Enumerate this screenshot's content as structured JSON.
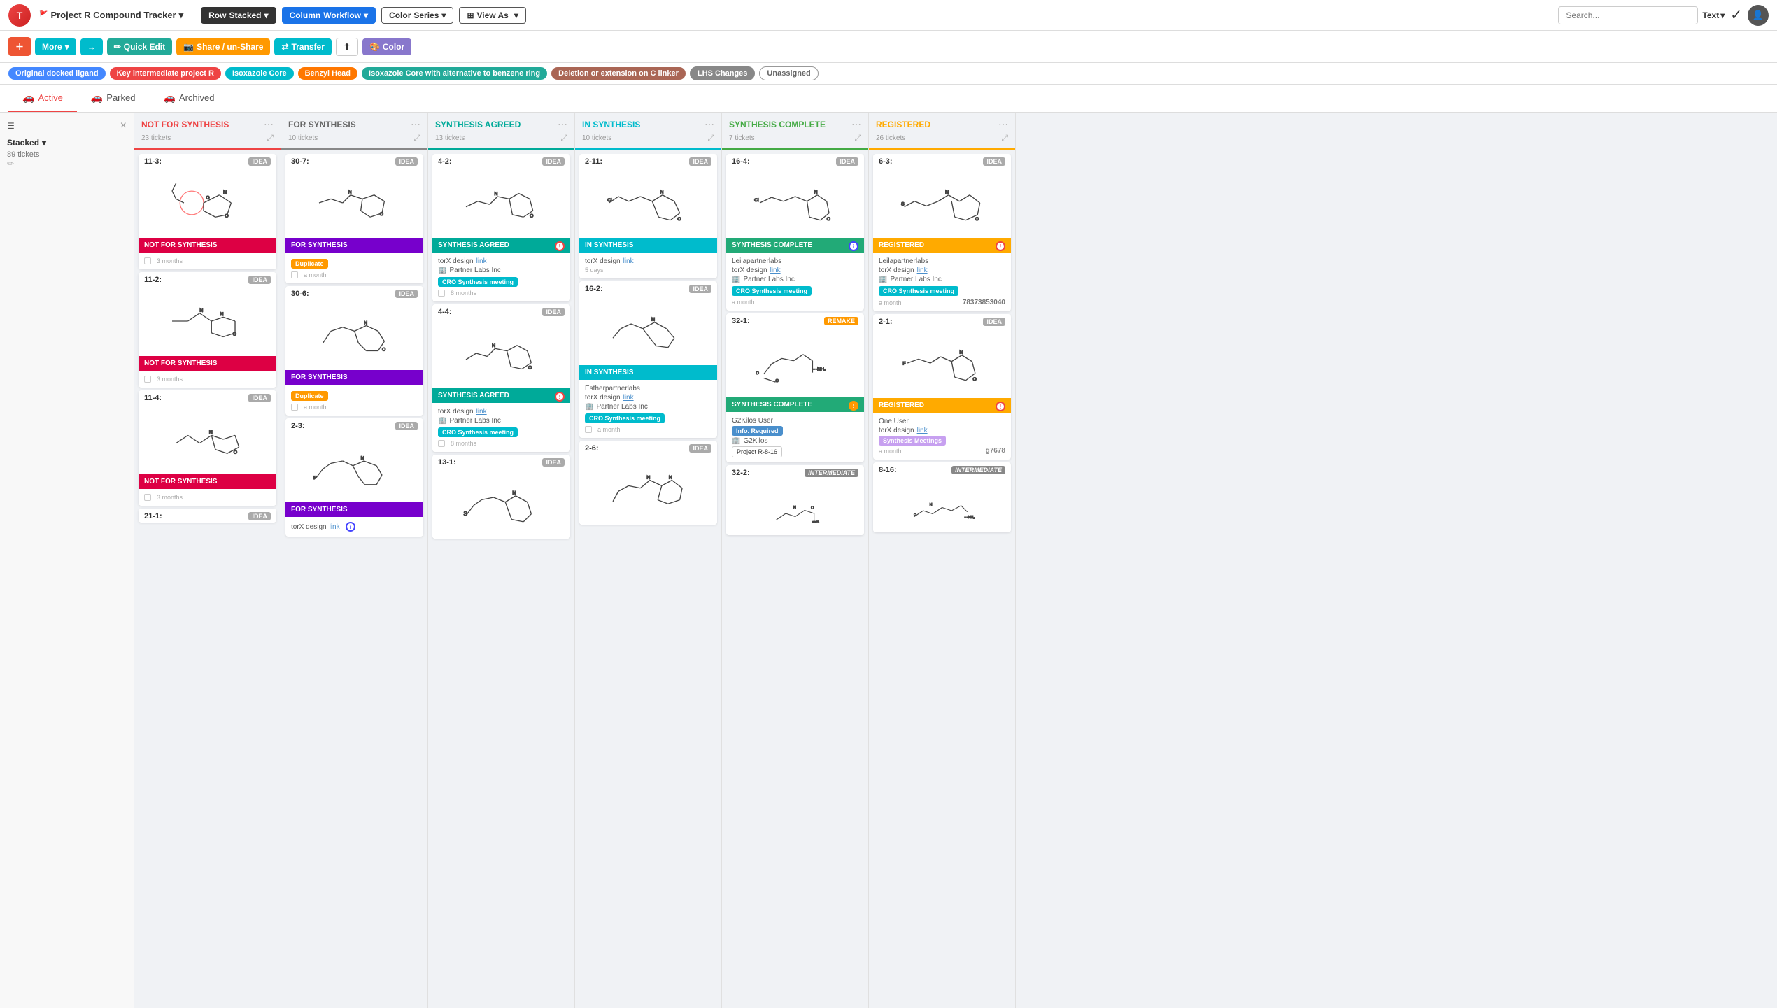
{
  "app": {
    "logo": "T",
    "project": "Project R Compound Tracker",
    "checkmark": "✓"
  },
  "topnav": {
    "row_label": "Row",
    "row_value": "Stacked",
    "col_label": "Column",
    "col_value": "Workflow",
    "color_label": "Color",
    "color_value": "Series",
    "viewas_label": "View As",
    "search_placeholder": "Search...",
    "text_label": "Text"
  },
  "toolbar": {
    "more_label": "More",
    "quick_edit_label": "Quick Edit",
    "share_label": "Share / un-Share",
    "transfer_label": "Transfer",
    "share_icon_label": "share",
    "color_label": "Color"
  },
  "tags": [
    {
      "label": "Original docked ligand",
      "color": "blue"
    },
    {
      "label": "Key intermediate project R",
      "color": "pink"
    },
    {
      "label": "Isoxazole Core",
      "color": "cyan"
    },
    {
      "label": "Benzyl Head",
      "color": "orange"
    },
    {
      "label": "Isoxazole Core with alternative to benzene ring",
      "color": "green"
    },
    {
      "label": "Deletion or extension on C linker",
      "color": "brown"
    },
    {
      "label": "LHS Changes",
      "color": "gray"
    },
    {
      "label": "Unassigned",
      "color": "outline-gray"
    }
  ],
  "tabs": [
    {
      "label": "Active",
      "icon": "🚗",
      "active": true
    },
    {
      "label": "Parked",
      "icon": "🚗",
      "active": false
    },
    {
      "label": "Archived",
      "icon": "🚗",
      "active": false
    }
  ],
  "sidebar": {
    "filter_label": "Filter",
    "close_label": "×",
    "stacked_label": "Stacked",
    "tickets_label": "89 tickets"
  },
  "columns": [
    {
      "id": "not-for-synthesis",
      "title": "NOT FOR SYNTHESIS",
      "title_class": "not-synthesis",
      "divider_class": "not-synthesis",
      "tickets": "23 tickets",
      "cards": [
        {
          "id": "11-3",
          "badge": "IDEA",
          "badge_class": "idea",
          "has_molecule": true,
          "status": "NOT FOR SYNTHESIS",
          "status_class": "magenta",
          "time": "3 months",
          "has_checkbox": true
        },
        {
          "id": "11-2",
          "badge": "IDEA",
          "badge_class": "idea",
          "has_molecule": true,
          "status": "NOT FOR SYNTHESIS",
          "status_class": "magenta",
          "time": "3 months",
          "has_checkbox": true
        },
        {
          "id": "11-4",
          "badge": "IDEA",
          "badge_class": "idea",
          "has_molecule": true,
          "status": "NOT FOR SYNTHESIS",
          "status_class": "magenta",
          "time": "3 months",
          "has_checkbox": true
        },
        {
          "id": "21-1",
          "badge": "IDEA",
          "badge_class": "idea",
          "has_molecule": true,
          "status": "",
          "status_class": "",
          "time": ""
        }
      ]
    },
    {
      "id": "for-synthesis",
      "title": "FOR SYNTHESIS",
      "title_class": "for-synthesis",
      "divider_class": "for-synthesis",
      "tickets": "10 tickets",
      "cards": [
        {
          "id": "30-7",
          "badge": "IDEA",
          "badge_class": "idea",
          "has_molecule": true,
          "status": "FOR SYNTHESIS",
          "status_class": "purple",
          "time": "a month",
          "has_checkbox": true,
          "duplicate_tag": true
        },
        {
          "id": "30-6",
          "badge": "IDEA",
          "badge_class": "idea",
          "has_molecule": true,
          "status": "FOR SYNTHESIS",
          "status_class": "purple",
          "time": "a month",
          "has_checkbox": true,
          "duplicate_tag": true
        },
        {
          "id": "2-3",
          "badge": "IDEA",
          "badge_class": "idea",
          "has_molecule": true,
          "status": "FOR SYNTHESIS",
          "status_class": "purple",
          "time": "",
          "has_checkbox": false,
          "design_link": true
        }
      ]
    },
    {
      "id": "synthesis-agreed",
      "title": "SYNTHESIS AGREED",
      "title_class": "synthesis-agreed",
      "divider_class": "synthesis-agreed",
      "tickets": "13 tickets",
      "cards": [
        {
          "id": "4-2",
          "badge": "IDEA",
          "badge_class": "idea",
          "has_molecule": true,
          "status": "SYNTHESIS AGREED",
          "status_class": "green",
          "dot": "red",
          "partner": "Partner Labs Inc",
          "cro_tag": true,
          "time": "8 months",
          "has_checkbox": true,
          "design_link": true
        },
        {
          "id": "4-4",
          "badge": "IDEA",
          "badge_class": "idea",
          "has_molecule": true,
          "status": "SYNTHESIS AGREED",
          "status_class": "green",
          "dot": "red",
          "partner": "Partner Labs Inc",
          "cro_tag": true,
          "time": "8 months",
          "has_checkbox": true,
          "design_link": true
        },
        {
          "id": "13-1",
          "badge": "IDEA",
          "badge_class": "idea",
          "has_molecule": true,
          "status": "",
          "status_class": "",
          "time": ""
        }
      ]
    },
    {
      "id": "in-synthesis",
      "title": "IN SYNTHESIS",
      "title_class": "in-synthesis",
      "divider_class": "in-synthesis",
      "tickets": "10 tickets",
      "cards": [
        {
          "id": "2-11",
          "badge": "IDEA",
          "badge_class": "idea",
          "has_molecule": true,
          "status": "IN SYNTHESIS",
          "status_class": "cyan",
          "partner": "Partner Labs Inc",
          "cro_tag": true,
          "time": "5 days",
          "has_checkbox": true,
          "design_link": true
        },
        {
          "id": "16-2",
          "badge": "IDEA",
          "badge_class": "idea",
          "has_molecule": true,
          "status": "IN SYNTHESIS",
          "status_class": "cyan",
          "partner": "Estherpartnerlabs",
          "cro_tag": true,
          "time": "a month",
          "has_checkbox": true,
          "design_link": true
        },
        {
          "id": "2-6",
          "badge": "IDEA",
          "badge_class": "idea",
          "has_molecule": true,
          "status": "",
          "status_class": "",
          "time": ""
        }
      ]
    },
    {
      "id": "synthesis-complete",
      "title": "SYNTHESIS COMPLETE",
      "title_class": "synthesis-complete",
      "divider_class": "synthesis-complete",
      "tickets": "7 tickets",
      "cards": [
        {
          "id": "16-4",
          "badge": "IDEA",
          "badge_class": "idea",
          "has_molecule": true,
          "status": "SYNTHESIS COMPLETE",
          "status_class": "dark-green",
          "dot": "blue",
          "org": "Leilapartnerlabs",
          "partner": "Partner Labs Inc",
          "cro_tag": true,
          "time": "a month",
          "design_link": true
        },
        {
          "id": "32-1",
          "badge": "REMAKE",
          "badge_class": "remake",
          "has_molecule": true,
          "status": "SYNTHESIS COMPLETE",
          "status_class": "dark-green",
          "dot": "orange",
          "org": "G2Kilos User",
          "partner": "G2Kilos",
          "cro_tag": false,
          "time": "",
          "info_required": true,
          "project_tag": "Project R-8-16"
        },
        {
          "id": "32-2",
          "badge": "INTERMEDIATE",
          "badge_class": "intermediate",
          "has_molecule": true,
          "status": "",
          "status_class": "",
          "time": "",
          "and1_label": "and1"
        }
      ]
    },
    {
      "id": "registered",
      "title": "REGISTERED",
      "title_class": "registered",
      "divider_class": "registered",
      "tickets": "26 tickets",
      "cards": [
        {
          "id": "6-3",
          "badge": "IDEA",
          "badge_class": "idea",
          "has_molecule": true,
          "status": "REGISTERED",
          "status_class": "registered",
          "dot": "red",
          "org": "Leilapartnerlabs",
          "partner": "Partner Labs Inc",
          "cro_tag": true,
          "time": "a month",
          "design_link": true,
          "phone": "78373853040"
        },
        {
          "id": "2-1",
          "badge": "IDEA",
          "badge_class": "idea",
          "has_molecule": true,
          "status": "REGISTERED",
          "status_class": "registered",
          "dot": "red",
          "org": "One User",
          "partner": "",
          "cro_tag": false,
          "time": "a month",
          "design_link": true,
          "synthesis_meetings": true,
          "code": "g7678"
        },
        {
          "id": "8-16",
          "badge": "INTERMEDIATE",
          "badge_class": "intermediate",
          "has_molecule": true,
          "status": "",
          "status_class": "",
          "time": ""
        }
      ]
    }
  ]
}
